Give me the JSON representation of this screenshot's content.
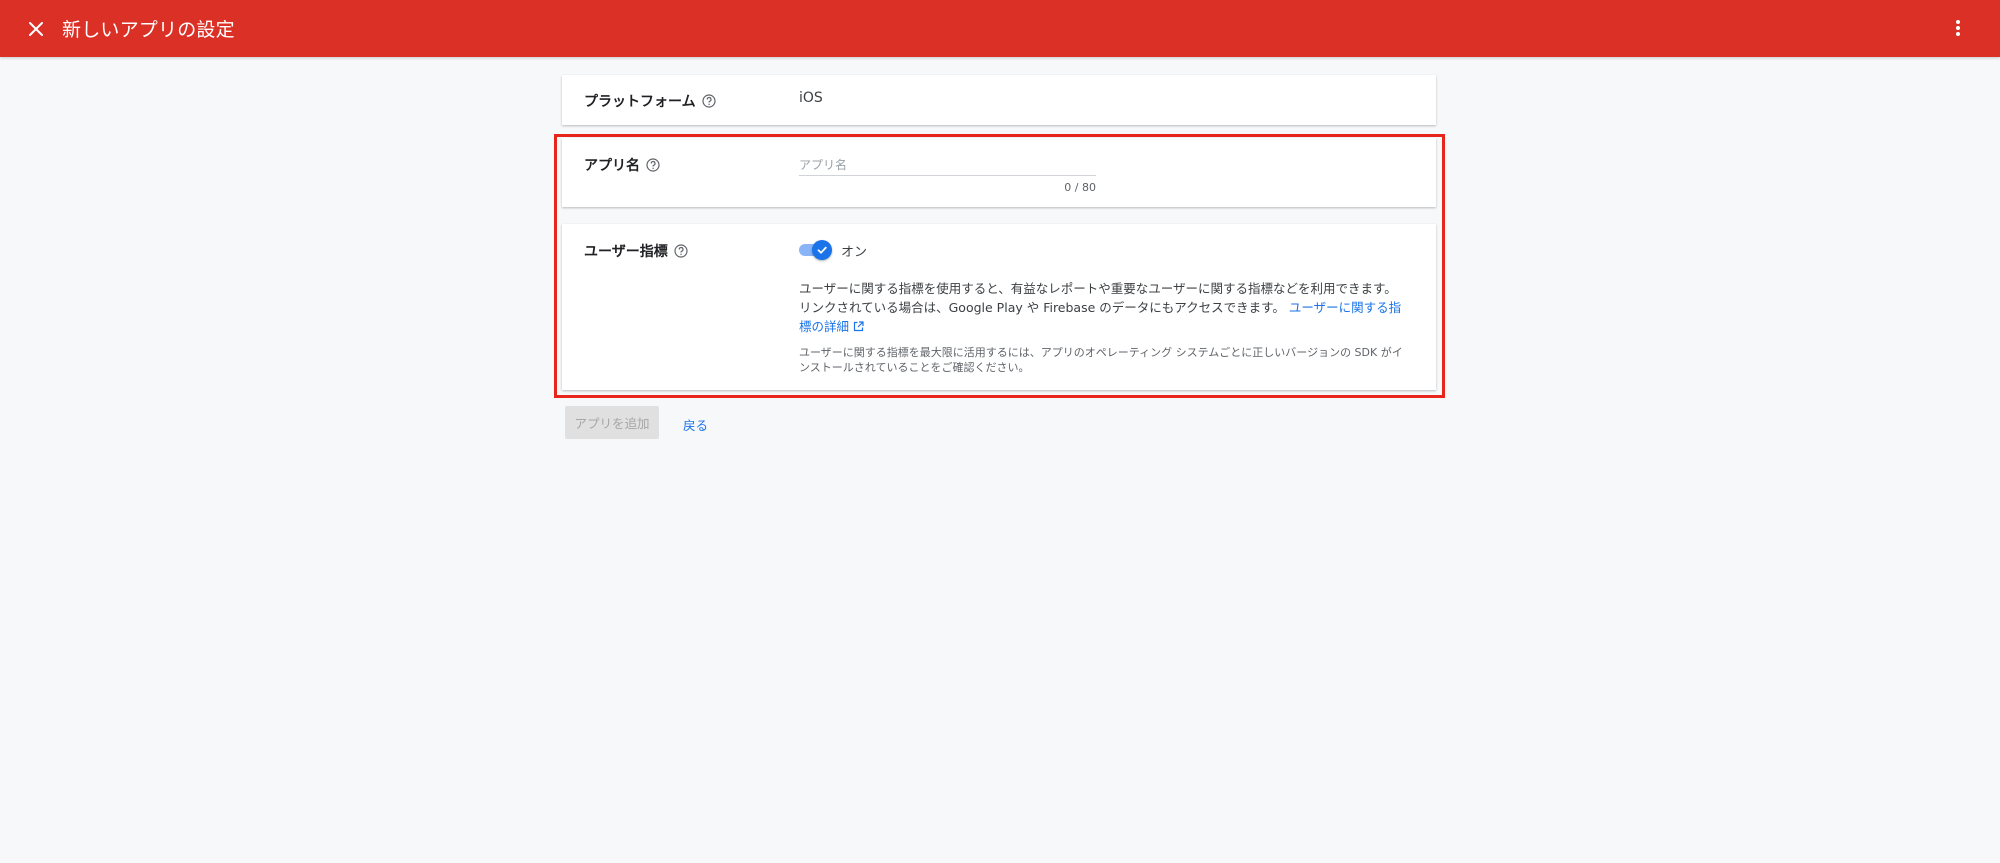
{
  "topbar": {
    "title": "新しいアプリの設定",
    "background": "#db3026"
  },
  "platform": {
    "label": "プラットフォーム",
    "value": "iOS"
  },
  "app_name": {
    "label": "アプリ名",
    "placeholder": "アプリ名",
    "value": "",
    "char_count": "0 / 80"
  },
  "user_metrics": {
    "label": "ユーザー指標",
    "toggle_on": true,
    "toggle_label": "オン",
    "description": "ユーザーに関する指標を使用すると、有益なレポートや重要なユーザーに関する指標などを利用できます。リンクされている場合は、Google Play や Firebase のデータにもアクセスできます。",
    "link_text": "ユーザーに関する指標の詳細",
    "note": "ユーザーに関する指標を最大限に活用するには、アプリのオペレーティング システムごとに正しいバージョンの SDK がインストールされていることをご確認ください。"
  },
  "actions": {
    "add_label": "アプリを追加",
    "back_label": "戻る"
  },
  "icons": {
    "close": "close-icon",
    "more": "more-vert-icon",
    "help": "help-outline-icon",
    "check": "check-icon",
    "external": "open-in-new-icon"
  },
  "colors": {
    "accent": "#1a73e8",
    "highlight": "#e8251a"
  }
}
